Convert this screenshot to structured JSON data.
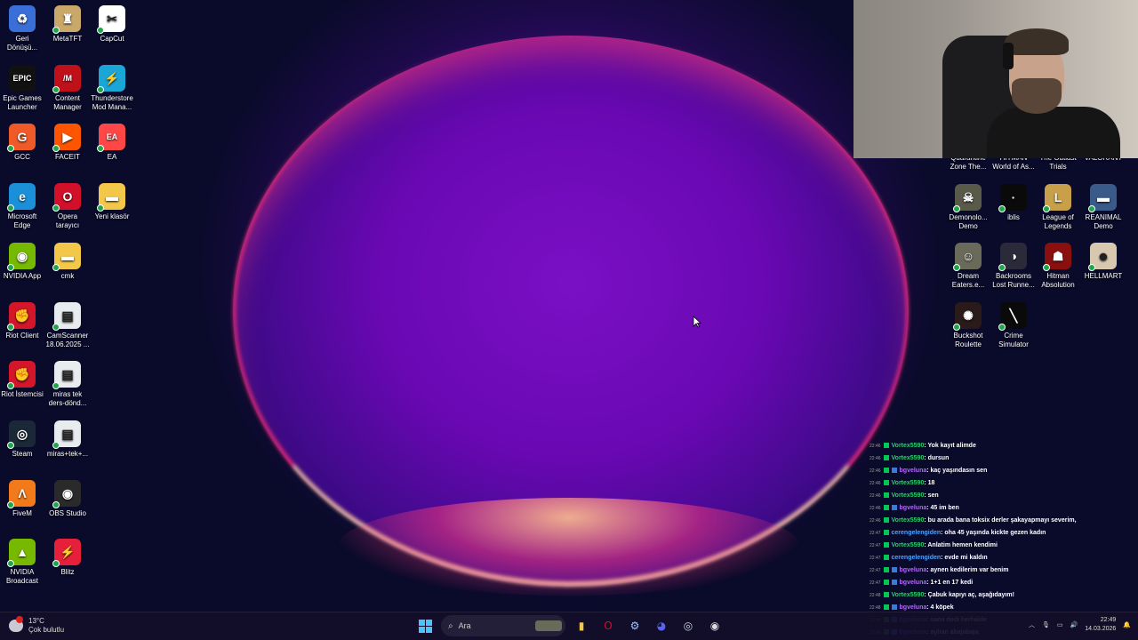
{
  "desktop": {
    "left_icons": [
      {
        "label": "Geri Dönüşü...",
        "glyph": "♻",
        "color": "#3b6fd8"
      },
      {
        "label": "MetaTFT",
        "glyph": "♜",
        "color": "#caa86a"
      },
      {
        "label": "CapCut",
        "glyph": "✂",
        "color": "#ffffff"
      },
      {
        "label": "Epic Games Launcher",
        "glyph": "EPIC",
        "color": "#111111"
      },
      {
        "label": "Content Manager",
        "glyph": "/M",
        "color": "#c0101a"
      },
      {
        "label": "Thunderstore Mod Mana...",
        "glyph": "⚡",
        "color": "#1aa6d6"
      },
      {
        "label": "GCC",
        "glyph": "G",
        "color": "#f05a28"
      },
      {
        "label": "FACEIT",
        "glyph": "▶",
        "color": "#ff5500"
      },
      {
        "label": "EA",
        "glyph": "EA",
        "color": "#ff4747"
      },
      {
        "label": "Microsoft Edge",
        "glyph": "e",
        "color": "#1b8fd8"
      },
      {
        "label": "Opera tarayıcı",
        "glyph": "O",
        "color": "#d3102a"
      },
      {
        "label": "Yeni klasör",
        "glyph": "▬",
        "color": "#f3c84a"
      },
      {
        "label": "NVIDIA App",
        "glyph": "◉",
        "color": "#76b900"
      },
      {
        "label": "cmk",
        "glyph": "▬",
        "color": "#f3c84a"
      },
      {
        "label": "Riot Client",
        "glyph": "✊",
        "color": "#d3162a"
      },
      {
        "label": "CamScanner 18.06.2025 ...",
        "glyph": "▤",
        "color": "#e8ecef"
      },
      {
        "label": "Riot İstemcisi",
        "glyph": "✊",
        "color": "#d3162a"
      },
      {
        "label": "miras tek ders-dönd...",
        "glyph": "▤",
        "color": "#e8ecef"
      },
      {
        "label": "Steam",
        "glyph": "◎",
        "color": "#1b2838"
      },
      {
        "label": "miras+tek+...",
        "glyph": "▤",
        "color": "#e8ecef"
      },
      {
        "label": "FiveM",
        "glyph": "Λ",
        "color": "#f27a1a"
      },
      {
        "label": "OBS Studio",
        "glyph": "◉",
        "color": "#2a2a2a"
      },
      {
        "label": "NVIDIA Broadcast",
        "glyph": "▲",
        "color": "#76b900"
      },
      {
        "label": "Blitz",
        "glyph": "⚡",
        "color": "#e6203a"
      }
    ],
    "right_icons": [
      {
        "label": "Quarantine Zone The...",
        "glyph": "",
        "color": "#333333"
      },
      {
        "label": "HITMAN World of As...",
        "glyph": "",
        "color": "#333333"
      },
      {
        "label": "The Outlast Trials",
        "glyph": "",
        "color": "#333333"
      },
      {
        "label": "VALORANT",
        "glyph": "",
        "color": "#333333"
      },
      {
        "label": "Demonolo... Demo",
        "glyph": "☠",
        "color": "#5a5a4a"
      },
      {
        "label": "iblis",
        "glyph": "·",
        "color": "#0a0a0a"
      },
      {
        "label": "League of Legends",
        "glyph": "L",
        "color": "#c8a04a"
      },
      {
        "label": "REANIMAL Demo",
        "glyph": "▬",
        "color": "#3a5a8a"
      },
      {
        "label": "Dream Eaters.e...",
        "glyph": "☺",
        "color": "#6a6a5a"
      },
      {
        "label": "Backrooms Lost Runne...",
        "glyph": "◑",
        "color": "#2a2a3a"
      },
      {
        "label": "Hitman Absolution",
        "glyph": "☗",
        "color": "#8a1010"
      },
      {
        "label": "HELLMART",
        "glyph": "☻",
        "color": "#d8c8b0"
      },
      {
        "label": "Buckshot Roulette",
        "glyph": "✺",
        "color": "#2a1a1a"
      },
      {
        "label": "Crime Simulator",
        "glyph": "╲",
        "color": "#0a0a0a"
      }
    ]
  },
  "chat": {
    "messages": [
      {
        "time": "22:46",
        "user": "Vortex5590",
        "user_color": "#2ecc71",
        "sub": false,
        "text": ": Yok kayıt alimde"
      },
      {
        "time": "22:46",
        "user": "Vortex5590",
        "user_color": "#2ecc71",
        "sub": false,
        "text": ": dursun"
      },
      {
        "time": "22:46",
        "user": "bgveluna",
        "user_color": "#b565ff",
        "sub": true,
        "text": ": kaç yaşındasın sen"
      },
      {
        "time": "22:46",
        "user": "Vortex5590",
        "user_color": "#2ecc71",
        "sub": false,
        "text": ": 18"
      },
      {
        "time": "22:46",
        "user": "Vortex5590",
        "user_color": "#2ecc71",
        "sub": false,
        "text": ": sen"
      },
      {
        "time": "22:46",
        "user": "bgveluna",
        "user_color": "#b565ff",
        "sub": true,
        "text": ": 45 im ben"
      },
      {
        "time": "22:46",
        "user": "Vortex5590",
        "user_color": "#2ecc71",
        "sub": false,
        "text": ": bu arada bana toksix derler şakayapmayı severim,"
      },
      {
        "time": "22:47",
        "user": "cerengelengiden",
        "user_color": "#4fa3ff",
        "sub": false,
        "text": ": oha 45 yaşında kickte gezen kadın"
      },
      {
        "time": "22:47",
        "user": "Vortex5590",
        "user_color": "#2ecc71",
        "sub": false,
        "text": ": Anlatim hemen kendimi"
      },
      {
        "time": "22:47",
        "user": "cerengelengiden",
        "user_color": "#4fa3ff",
        "sub": false,
        "text": ": evde mi kaldın"
      },
      {
        "time": "22:47",
        "user": "bgveluna",
        "user_color": "#b565ff",
        "sub": true,
        "text": ": aynen kedilerim var benim"
      },
      {
        "time": "22:47",
        "user": "bgveluna",
        "user_color": "#b565ff",
        "sub": true,
        "text": ": 1+1 en 17 kedi"
      },
      {
        "time": "22:48",
        "user": "Vortex5590",
        "user_color": "#2ecc71",
        "sub": false,
        "text": ": Çabuk kapıyı aç, aşağıdayım!"
      },
      {
        "time": "22:48",
        "user": "bgveluna",
        "user_color": "#b565ff",
        "sub": true,
        "text": ": 4 köpek"
      },
      {
        "time": "22:48",
        "user": "bgveluna",
        "user_color": "#b565ff",
        "sub": true,
        "text": ": sana dedi herhalde"
      },
      {
        "time": "22:48",
        "user": "bgveluna",
        "user_color": "#b565ff",
        "sub": true,
        "text": ": ayhan abajabaja"
      }
    ]
  },
  "taskbar": {
    "weather_temp": "13°C",
    "weather_desc": "Çok bulutlu",
    "search_placeholder": "Ara",
    "apps": [
      {
        "name": "file-explorer",
        "glyph": "▮",
        "color": "#f3c84a"
      },
      {
        "name": "opera",
        "glyph": "O",
        "color": "#d3102a"
      },
      {
        "name": "settings",
        "glyph": "⚙",
        "color": "#a0c4ff"
      },
      {
        "name": "discord",
        "glyph": "◕",
        "color": "#5865f2"
      },
      {
        "name": "steam",
        "glyph": "◎",
        "color": "#c7d5e0"
      },
      {
        "name": "obs",
        "glyph": "◉",
        "color": "#dddddd"
      }
    ],
    "time": "22:49",
    "date": "14.03.2026"
  }
}
